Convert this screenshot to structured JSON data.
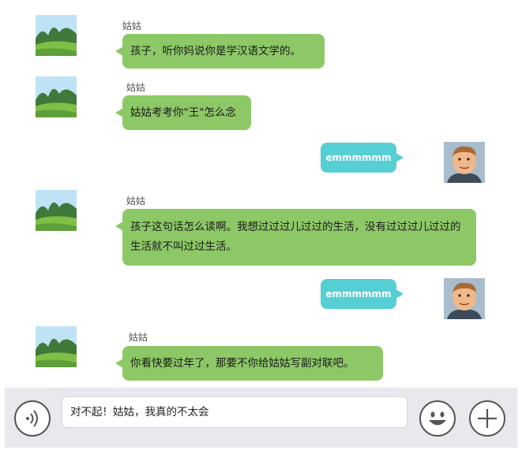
{
  "messages": [
    {
      "side": "left",
      "sender": "姑姑",
      "text": "孩子，听你妈说你是学汉语文学的。"
    },
    {
      "side": "left",
      "sender": "姑姑",
      "text": "姑姑考考你\"王\"怎么念"
    },
    {
      "side": "right",
      "text": "emmmmmm"
    },
    {
      "side": "left",
      "sender": "姑姑",
      "text": "孩子这句话怎么读啊。我想过过过儿过过的生活，没有过过过儿过过的生活就不叫过过生活。"
    },
    {
      "side": "right",
      "text": "emmmmmm"
    },
    {
      "side": "left",
      "sender": "姑姑",
      "text": "你看快要过年了，那要不你给姑姑写副对联吧。"
    }
  ],
  "input": {
    "value": "对不起！姑姑，我真的不太会"
  },
  "icons": {
    "voice": "voice-icon",
    "emoji": "emoji-icon",
    "plus": "plus-icon"
  },
  "colors": {
    "left_bubble": "#8dc867",
    "right_bubble": "#56cfd4",
    "input_bar": "#eae8ec"
  }
}
